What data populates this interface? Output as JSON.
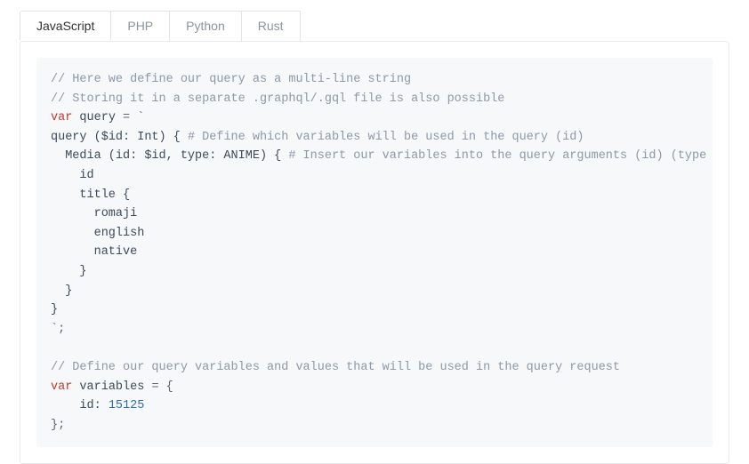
{
  "tabs": [
    {
      "label": "JavaScript",
      "active": true
    },
    {
      "label": "PHP",
      "active": false
    },
    {
      "label": "Python",
      "active": false
    },
    {
      "label": "Rust",
      "active": false
    }
  ],
  "code": {
    "c1": "// Here we define our query as a multi-line string",
    "c2": "// Storing it in a separate .graphql/.gql file is also possible",
    "kw_var1": "var",
    "ident_query": " query ",
    "eq_backtick": "= `",
    "l_query_open": "query (",
    "l_id_sig": "$id: Int",
    "l_query_close": ") { ",
    "l_query_comment": "# Define which variables will be used in the query (id)",
    "l_media_indent": "  Media (id: $id, type: ANIME) { ",
    "l_media_comment": "# Insert our variables into the query arguments (id) (type",
    "l_id": "    id",
    "l_title_open": "    title {",
    "l_romaji": "      romaji",
    "l_english": "      english",
    "l_native": "      native",
    "l_close1": "    }",
    "l_close2": "  }",
    "l_close3": "}",
    "l_backtick_end": "`;",
    "blank": "",
    "c3": "// Define our query variables and values that will be used in the query request",
    "kw_var2": "var",
    "ident_vars": " variables ",
    "eq_brace": "= {",
    "l_var_id_key": "    id: ",
    "l_var_id_val": "15125",
    "l_close4": "};"
  }
}
